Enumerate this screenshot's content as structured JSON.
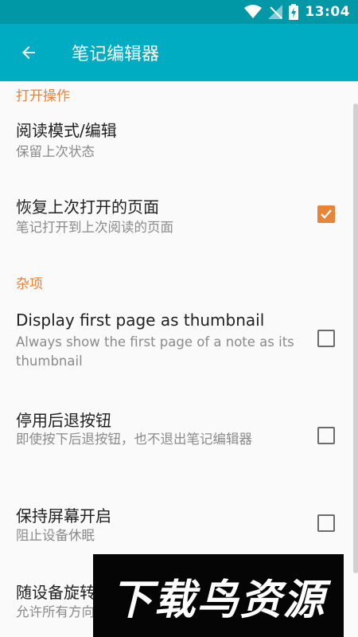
{
  "status_bar": {
    "time": "13:04"
  },
  "app_bar": {
    "title": "笔记编辑器"
  },
  "sections": [
    {
      "header": "打开操作"
    },
    {
      "header": "杂项"
    }
  ],
  "preferences": [
    {
      "title": "阅读模式/编辑",
      "summary": "保留上次状态"
    },
    {
      "title": "恢复上次打开的页面",
      "summary": "笔记打开到上次阅读的页面",
      "checked": true
    },
    {
      "title": "Display first page as thumbnail",
      "summary": "Always show the first page of a note as its thumbnail",
      "checked": false
    },
    {
      "title": "停用后退按钮",
      "summary": "即使按下后退按钮，也不退出笔记编辑器",
      "checked": false
    },
    {
      "title": "保持屏幕开启",
      "summary": "阻止设备休眠",
      "checked": false
    },
    {
      "title": "随设备旋转",
      "summary": "允许所有方向"
    }
  ],
  "watermark": {
    "text": "下载鸟资源"
  },
  "colors": {
    "status_bar": "#0097a7",
    "app_bar": "#00acc1",
    "accent": "#e8833a"
  }
}
